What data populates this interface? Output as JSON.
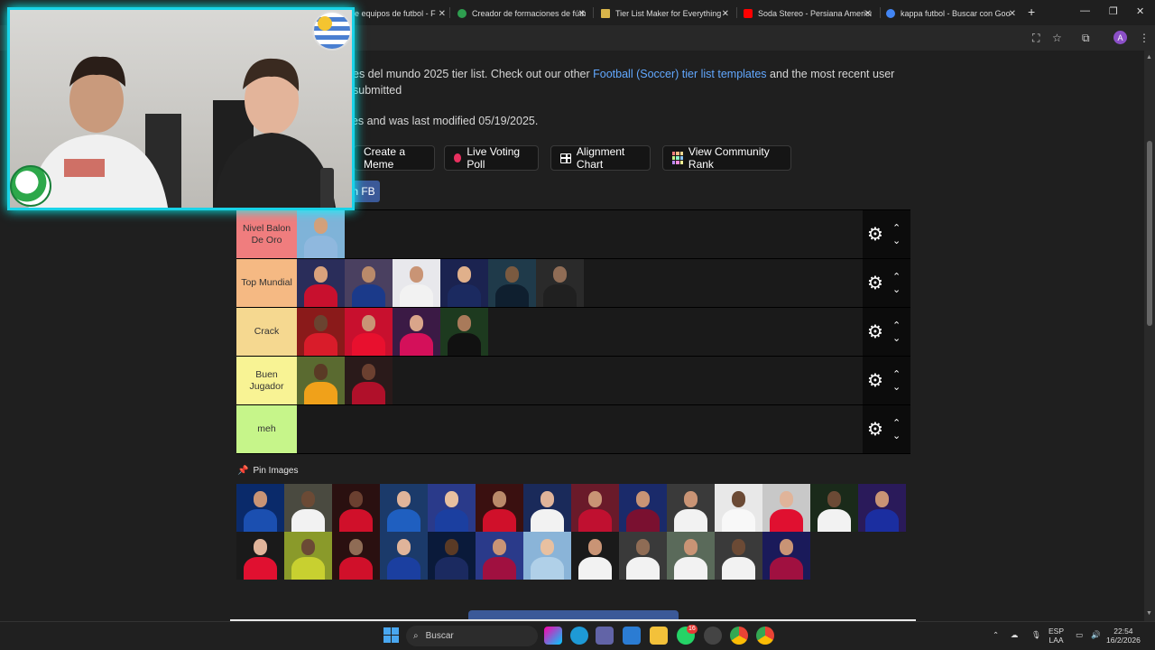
{
  "browser": {
    "tabs": [
      {
        "label": "de equipos de futbol - F",
        "icon_color": "#3a8ee6"
      },
      {
        "label": "Creador de formaciones de fútb",
        "icon_color": "#2e9e4f"
      },
      {
        "label": "Tier List Maker for Everything -",
        "icon_color": "#d9b54a"
      },
      {
        "label": "Soda Stereo - Persiana America",
        "icon_color": "#ff0000"
      },
      {
        "label": "kappa futbol - Buscar con Goo",
        "icon_color": "#4285f4"
      }
    ],
    "new_tab": "+",
    "window_controls": [
      "—",
      "❐",
      "✕"
    ],
    "profile_letter": "A"
  },
  "intro": {
    "text_before": "es del mundo 2025 tier list. Check out our other ",
    "link": "Football (Soccer) tier list templates",
    "text_after": " and the most recent user submitted",
    "modified": "ges and was last modified 05/19/2025."
  },
  "actions": {
    "meme": "Create a Meme",
    "poll": "Live Voting Poll",
    "alignment": "Alignment Chart",
    "community": "View Community Rank",
    "share_fb": "n FB"
  },
  "tiers": [
    {
      "label": "Nivel Balon De Oro",
      "color": "#f07d7e",
      "items": [
        [
          "#7fb3d8",
          "#d4a07a",
          "#8fb8de"
        ]
      ]
    },
    {
      "label": "Top Mundial",
      "color": "#f5b983",
      "items": [
        [
          "#2a2d5a",
          "#d9a27c",
          "#c8102e"
        ],
        [
          "#4a4060",
          "#b98a6a",
          "#1b3a8a"
        ],
        [
          "#e8e8ec",
          "#c99475",
          "#f2f2f2"
        ],
        [
          "#1b2350",
          "#e0b08b",
          "#1b2a60"
        ],
        [
          "#1f3a4a",
          "#7a5a40",
          "#0f1f2f"
        ],
        [
          "#2a2a2a",
          "#8f6c55",
          "#202020"
        ]
      ]
    },
    {
      "label": "Crack",
      "color": "#f5d890",
      "items": [
        [
          "#8a1a1a",
          "#6a4330",
          "#d91c2a"
        ],
        [
          "#c8102e",
          "#c99475",
          "#e8102e"
        ],
        [
          "#3b1a45",
          "#d9a58a",
          "#d4105a"
        ],
        [
          "#1d3a1f",
          "#a97a5a",
          "#111111"
        ]
      ]
    },
    {
      "label": "Buen Jugador",
      "color": "#f8f394",
      "items": [
        [
          "#5a6a30",
          "#5a3a25",
          "#f0a11a"
        ],
        [
          "#2a1a1a",
          "#6b4030",
          "#b0102a"
        ]
      ]
    },
    {
      "label": "meh",
      "color": "#c6f58a",
      "items": []
    }
  ],
  "tier_controls": {
    "gear": "⚙",
    "up": "⌃",
    "down": "⌄"
  },
  "pin": {
    "icon": "📌",
    "title": "Pin Images"
  },
  "pool": [
    [
      "#0a2a6a",
      "#c99475",
      "#1b4fb0"
    ],
    [
      "#4a4a40",
      "#6b4a35",
      "#f2f2f2"
    ],
    [
      "#2a1010",
      "#6b4030",
      "#d0102a"
    ],
    [
      "#1b3a6a",
      "#e0b49a",
      "#1f5fc0"
    ],
    [
      "#2a3a8a",
      "#e8c0a0",
      "#1b3fa0"
    ],
    [
      "#3a1010",
      "#b98a6a",
      "#d0102a"
    ],
    [
      "#1a2a5a",
      "#e0b49a",
      "#f2f2f2"
    ],
    [
      "#6a1a2a",
      "#c99475",
      "#c01030"
    ],
    [
      "#1a2a6a",
      "#c99475",
      "#7a1030"
    ],
    [
      "#3a3a3a",
      "#c99475",
      "#f2f2f2"
    ],
    [
      "#e8e8e8",
      "#6b4a35",
      "#f8f8f8"
    ],
    [
      "#c8c8c8",
      "#e0b49a",
      "#e01030"
    ],
    [
      "#1a2a1a",
      "#6b4a35",
      "#f2f2f2"
    ],
    [
      "#2a1a5a",
      "#c99475",
      "#1b2ea0"
    ],
    [
      "#1a1a1a",
      "#e0b49a",
      "#e01030"
    ],
    [
      "#8a9a2a",
      "#6b4a35",
      "#c8d030"
    ],
    [
      "#2a1010",
      "#8f6c55",
      "#d0102a"
    ],
    [
      "#1b3a6a",
      "#e0b49a",
      "#1b3fa0"
    ],
    [
      "#0a1a3a",
      "#5a3a25",
      "#1b2a60"
    ],
    [
      "#2a3a8a",
      "#c99475",
      "#a01040"
    ],
    [
      "#8ab4d8",
      "#e8c0a0",
      "#b0d0e8"
    ],
    [
      "#1a1a1a",
      "#c99475",
      "#f2f2f2"
    ],
    [
      "#3a3a3a",
      "#8f6c55",
      "#f2f2f2"
    ],
    [
      "#5a6a5a",
      "#c99475",
      "#f2f2f2"
    ],
    [
      "#3a3a3a",
      "#6b4a35",
      "#f2f2f2"
    ],
    [
      "#1a1a5a",
      "#c99475",
      "#a01040"
    ]
  ],
  "taskbar": {
    "search": "Buscar",
    "lang_top": "ESP",
    "lang_bottom": "LAA",
    "time": "22:54",
    "date": "16/2/2026",
    "badge": "16"
  }
}
